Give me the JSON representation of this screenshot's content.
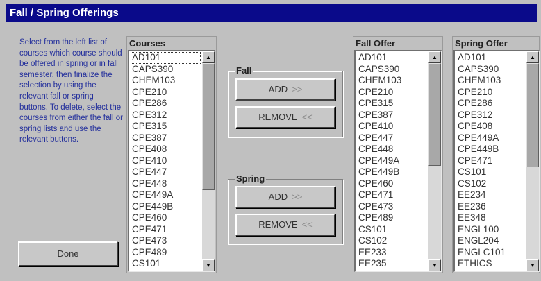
{
  "window": {
    "title": "Fall / Spring Offerings"
  },
  "instructions": "Select from the left list of courses which course should be offered in spring or in fall semester, then finalize the selection by using the relevant fall or spring buttons. To delete, select the courses from either the fall or spring lists and use the relevant buttons.",
  "buttons": {
    "done": "Done"
  },
  "fall_group": {
    "title": "Fall",
    "add_label": "ADD",
    "add_arrows": ">>",
    "remove_label": "REMOVE",
    "remove_arrows": "<<"
  },
  "spring_group": {
    "title": "Spring",
    "add_label": "ADD",
    "add_arrows": ">>",
    "remove_label": "REMOVE",
    "remove_arrows": "<<"
  },
  "lists": {
    "courses": {
      "header": "Courses",
      "items": [
        "AD101",
        "CAPS390",
        "CHEM103",
        "CPE210",
        "CPE286",
        "CPE312",
        "CPE315",
        "CPE387",
        "CPE408",
        "CPE410",
        "CPE447",
        "CPE448",
        "CPE449A",
        "CPE449B",
        "CPE460",
        "CPE471",
        "CPE473",
        "CPE489",
        "CS101"
      ]
    },
    "fall": {
      "header": "Fall Offer",
      "items": [
        "AD101",
        "CAPS390",
        "CHEM103",
        "CPE210",
        "CPE315",
        "CPE387",
        "CPE410",
        "CPE447",
        "CPE448",
        "CPE449A",
        "CPE449B",
        "CPE460",
        "CPE471",
        "CPE473",
        "CPE489",
        "CS101",
        "CS102",
        "EE233",
        "EE235"
      ]
    },
    "spring": {
      "header": "Spring Offer",
      "items": [
        "AD101",
        "CAPS390",
        "CHEM103",
        "CPE210",
        "CPE286",
        "CPE312",
        "CPE408",
        "CPE449A",
        "CPE449B",
        "CPE471",
        "CS101",
        "CS102",
        "EE234",
        "EE236",
        "EE348",
        "ENGL100",
        "ENGL204",
        "ENGLC101",
        "ETHICS"
      ]
    }
  }
}
